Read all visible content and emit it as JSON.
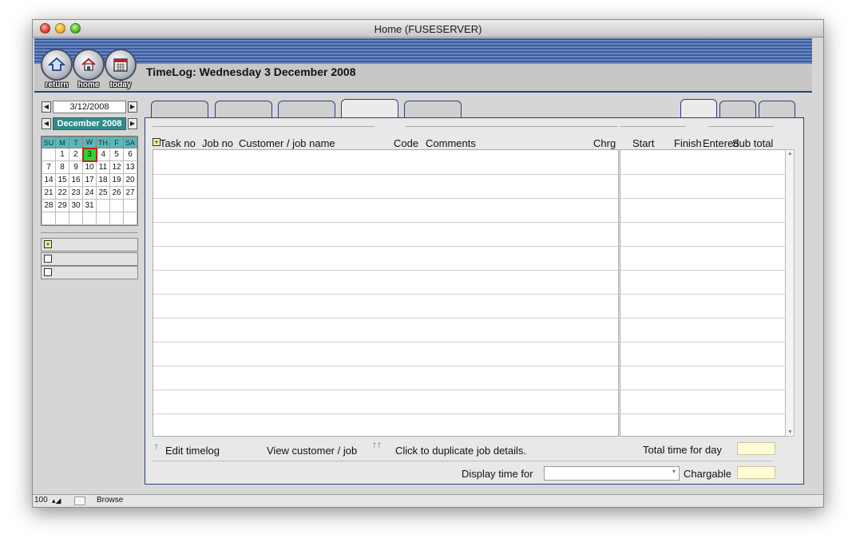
{
  "window": {
    "title": "Home (FUSESERVER)"
  },
  "nav": {
    "return_label": "return",
    "home_label": "home",
    "today_label": "today"
  },
  "header": {
    "title": "TimeLog: Wednesday 3 December 2008"
  },
  "sidebar": {
    "date_value": "3/12/2008",
    "month_label": "December 2008",
    "weekdays": [
      "SU",
      "M",
      "T",
      "W",
      "TH",
      "F",
      "SA"
    ],
    "weeks": [
      [
        "",
        "1",
        "2",
        "3",
        "4",
        "5",
        "6"
      ],
      [
        "7",
        "8",
        "9",
        "10",
        "11",
        "12",
        "13"
      ],
      [
        "14",
        "15",
        "16",
        "17",
        "18",
        "19",
        "20"
      ],
      [
        "21",
        "22",
        "23",
        "24",
        "25",
        "26",
        "27"
      ],
      [
        "28",
        "29",
        "30",
        "31",
        "",
        "",
        ""
      ],
      [
        "",
        "",
        "",
        "",
        "",
        "",
        ""
      ]
    ],
    "today": "3"
  },
  "table": {
    "headers": {
      "task_no": "Task no",
      "job_no": "Job no",
      "customer": "Customer / job name",
      "code": "Code",
      "comments": "Comments",
      "chrg": "Chrg",
      "start": "Start",
      "finish": "Finish",
      "entered": "Entered",
      "sub_total": "Sub total"
    },
    "row_count": 12
  },
  "footer": {
    "edit_timelog": "Edit timelog",
    "view_customer": "View customer / job",
    "duplicate": "Click to duplicate job details.",
    "total_time_label": "Total time for day",
    "display_time_label": "Display time for",
    "chargable_label": "Chargable"
  },
  "status": {
    "zoom": "100",
    "mode": "Browse"
  }
}
